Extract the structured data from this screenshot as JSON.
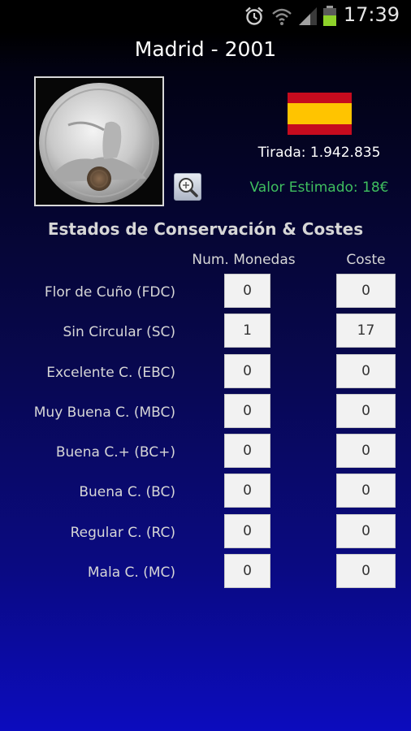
{
  "status_bar": {
    "time": "17:39",
    "icons": [
      "alarm-icon",
      "wifi-icon",
      "signal-icon",
      "battery-icon"
    ]
  },
  "header": {
    "title": "Madrid - 2001"
  },
  "coin": {
    "tirada": "Tirada: 1.942.835",
    "valor_estimado": "Valor Estimado: 18€",
    "flag_colors": [
      "#c60b1e",
      "#ffc400",
      "#c60b1e"
    ]
  },
  "section": {
    "title": "Estados de Conservación & Costes",
    "col_num": "Num. Monedas",
    "col_cost": "Coste"
  },
  "rows": [
    {
      "label": "Flor de Cuño (FDC)",
      "num": "0",
      "cost": "0"
    },
    {
      "label": "Sin Circular (SC)",
      "num": "1",
      "cost": "17"
    },
    {
      "label": "Excelente C. (EBC)",
      "num": "0",
      "cost": "0"
    },
    {
      "label": "Muy Buena C. (MBC)",
      "num": "0",
      "cost": "0"
    },
    {
      "label": "Buena C.+ (BC+)",
      "num": "0",
      "cost": "0"
    },
    {
      "label": "Buena C. (BC)",
      "num": "0",
      "cost": "0"
    },
    {
      "label": "Regular C. (RC)",
      "num": "0",
      "cost": "0"
    },
    {
      "label": "Mala C. (MC)",
      "num": "0",
      "cost": "0"
    }
  ],
  "colors": {
    "accent_green": "#3fbf5f",
    "bg_bottom": "#0c0cbe"
  }
}
